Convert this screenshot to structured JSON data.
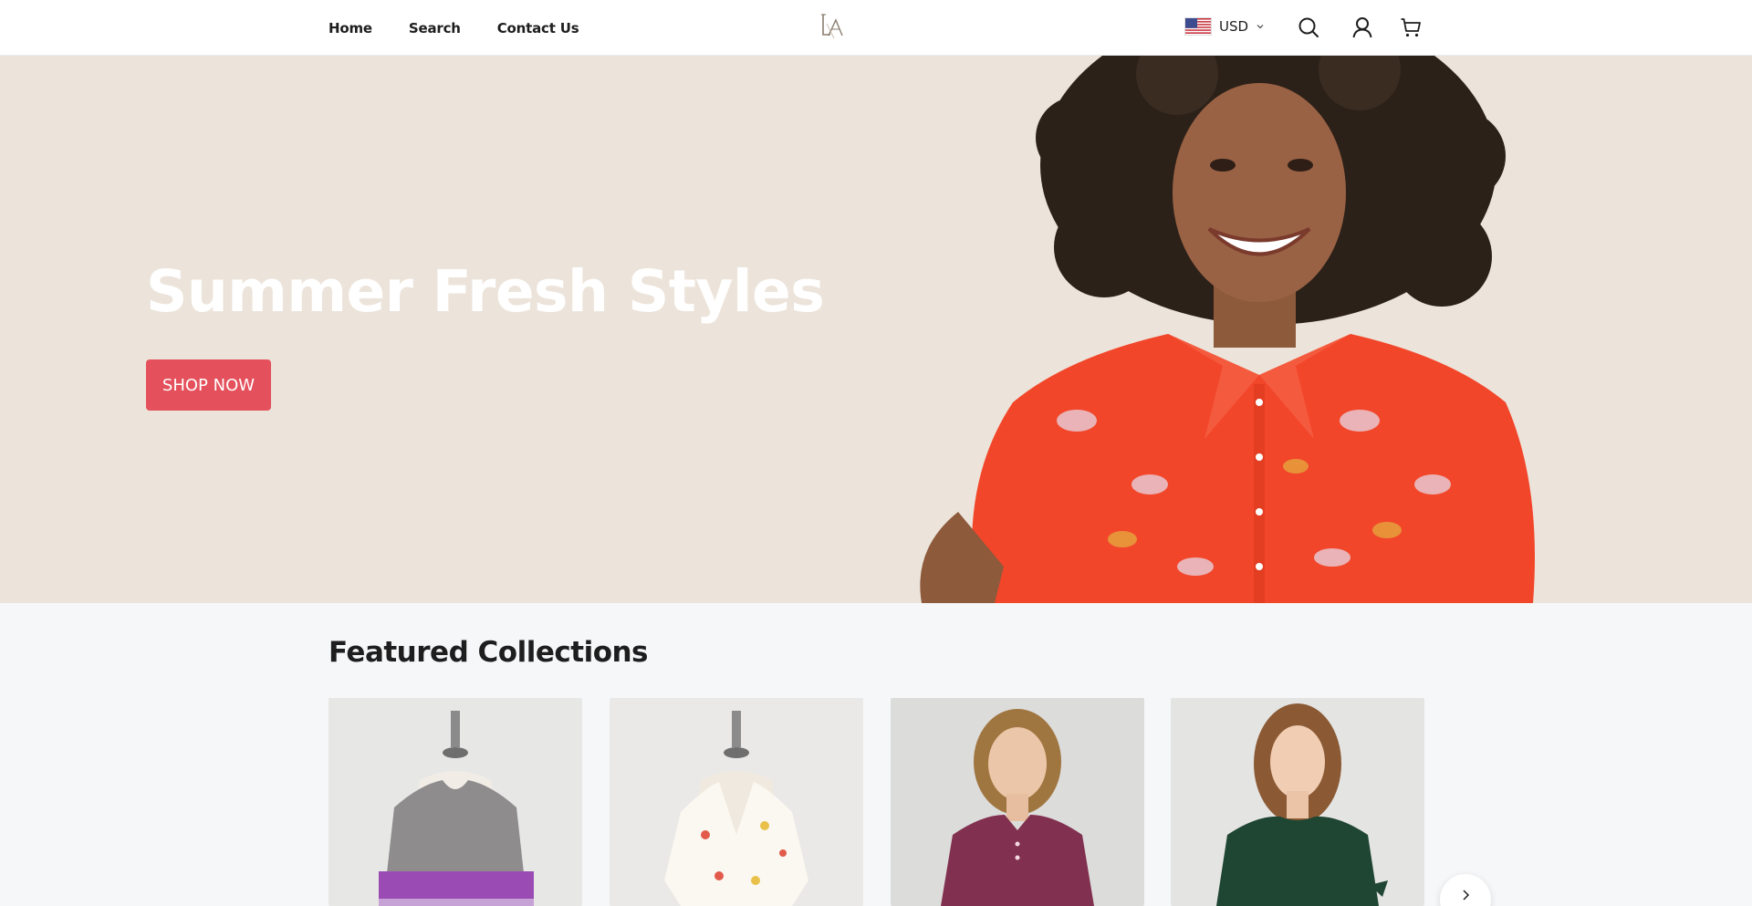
{
  "nav": {
    "items": [
      {
        "label": "Home"
      },
      {
        "label": "Search"
      },
      {
        "label": "Contact Us"
      }
    ]
  },
  "header": {
    "logo_icon": "la-monogram-logo",
    "currency": {
      "code": "USD",
      "flag_icon": "us-flag-icon"
    },
    "icons": [
      "search-icon",
      "account-icon",
      "cart-icon"
    ]
  },
  "hero": {
    "title": "Summer Fresh Styles",
    "button_label": "SHOP NOW",
    "button_color": "#e4505b",
    "background_color": "#ece4da"
  },
  "featured": {
    "title": "Featured Collections",
    "cards": [
      {
        "image": "grey-purple-striped-top-on-mannequin"
      },
      {
        "image": "white-fruit-print-top-on-mannequin"
      },
      {
        "image": "model-in-plum-henley-top"
      },
      {
        "image": "model-in-green-tie-sleeve-top"
      }
    ],
    "next_icon": "chevron-right-icon"
  }
}
